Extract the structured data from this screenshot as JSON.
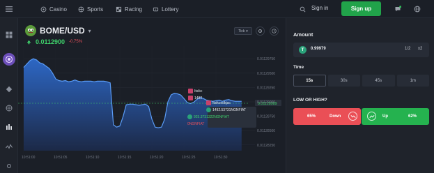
{
  "nav": {
    "items": [
      {
        "label": "Casino",
        "icon": "casino-icon"
      },
      {
        "label": "Sports",
        "icon": "sports-icon"
      },
      {
        "label": "Racing",
        "icon": "racing-icon"
      },
      {
        "label": "Lottery",
        "icon": "lottery-icon"
      }
    ],
    "signin": "Sign in",
    "signup": "Sign up"
  },
  "chart": {
    "pair": "BOME/USD",
    "price": "0.0112900",
    "change": "-0.75%",
    "tick_label": "Tick",
    "y_ticks": [
      "0.01129750",
      "0.01129500",
      "0.01129250",
      "0.01129000",
      "0.01128750",
      "0.01128500",
      "0.01128250"
    ],
    "x_ticks": [
      "10:51:00",
      "10:51:05",
      "10:51:10",
      "10:51:15",
      "10:51:20",
      "10:51:25",
      "10:51:30"
    ],
    "current_price_tag": "0.01128989",
    "trades": {
      "user1": "Itsikc",
      "user2": "Itsikcedkjac",
      "amount_a": "1492",
      "amount_b": "1492.53731NGNFIAT",
      "amount_c": "925.3731322NGNFIAT",
      "amount_d": "0NGNFIAT"
    }
  },
  "panel": {
    "amount_label": "Amount",
    "amount_value": "0.99979",
    "coin_symbol": "T",
    "half": "1/2",
    "double": "x2",
    "time_label": "Time",
    "times": [
      "15s",
      "30s",
      "45s",
      "1m"
    ],
    "active_time": "15s",
    "question": "LOW OR HIGH?",
    "down_pct": "65%",
    "down_label": "Down",
    "up_label": "Up",
    "up_pct": "62%"
  },
  "colors": {
    "up": "#25b24f",
    "down": "#ea4f56",
    "accent_green": "#3fd26b",
    "line": "#4a8ff0"
  },
  "chart_data": {
    "type": "area",
    "x": [
      0,
      0.5,
      1,
      1.5,
      2,
      2.5,
      3,
      3.5,
      4,
      4.5,
      5,
      5.5,
      6,
      6.5,
      7,
      7.5,
      8,
      8.5,
      9,
      9.5,
      10,
      10.5,
      11,
      11.5,
      12,
      12.5,
      13,
      13.5,
      14,
      14.5,
      15,
      15.5,
      16,
      16.5,
      17,
      17.5,
      18,
      18.5,
      19,
      19.5,
      20,
      20.5,
      21,
      21.5,
      22,
      22.5,
      23,
      23.5,
      24,
      24.5,
      25,
      25.5,
      26,
      26.5,
      27,
      27.5,
      28,
      28.5,
      29,
      29.5,
      30,
      30.5,
      31,
      31.5,
      32,
      32.5,
      33,
      33.5,
      34
    ],
    "y": [
      0.011296,
      0.0112966,
      0.0112972,
      0.0112975,
      0.0112973,
      0.0112968,
      0.0112966,
      0.0112962,
      0.0112958,
      0.011295,
      0.011294,
      0.0112937,
      0.0112936,
      0.0112937,
      0.0112935,
      0.0112936,
      0.0112938,
      0.0112936,
      0.0112935,
      0.0112936,
      0.0112936,
      0.0112936,
      0.0112935,
      0.0112936,
      0.0112936,
      0.0112936,
      0.0112935,
      0.0112933,
      0.011286,
      0.0112856,
      0.0112858,
      0.0112874,
      0.0112895,
      0.0112896,
      0.0112896,
      0.0112895,
      0.0112894,
      0.0112895,
      0.0112896,
      0.0112892,
      0.011287,
      0.0112856,
      0.0112855,
      0.0112856,
      0.011287,
      0.01129,
      0.0112912,
      0.0112915,
      0.0112914,
      0.0112912,
      0.0112906,
      0.0112899,
      0.0112897,
      0.0112899,
      0.0112904,
      0.0112908,
      0.0112906,
      0.0112903,
      0.0112902,
      0.0112901,
      0.0112902,
      0.0112903,
      0.0112901,
      0.0112903,
      0.0112904,
      0.0112902,
      0.0112901,
      0.0112901,
      0.0112901
    ],
    "xlabel": "",
    "ylabel": "",
    "x_tick_labels": [
      "10:51:00",
      "10:51:05",
      "10:51:10",
      "10:51:15",
      "10:51:20",
      "10:51:25",
      "10:51:30"
    ],
    "ylim": [
      0.0112815,
      0.0112985
    ],
    "grid": true
  }
}
